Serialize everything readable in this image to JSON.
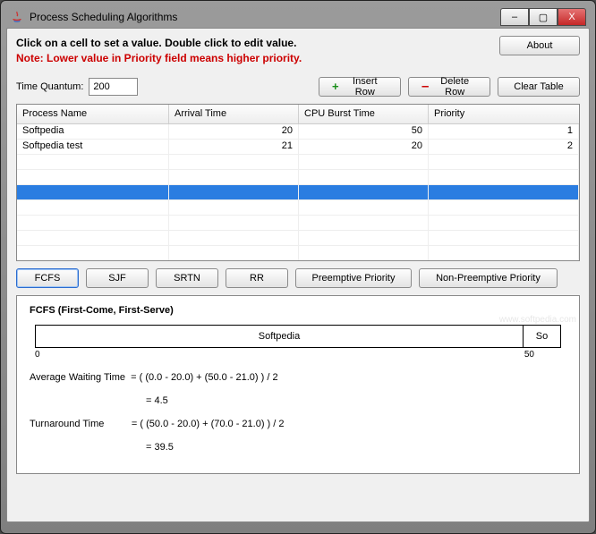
{
  "window": {
    "title": "Process Scheduling Algorithms"
  },
  "instructions": {
    "line1": "Click on a cell to set a value. Double click to edit value.",
    "line2": "Note: Lower value in Priority field means higher priority."
  },
  "about_label": "About",
  "quantum": {
    "label": "Time Quantum:",
    "value": "200"
  },
  "row_buttons": {
    "insert": "Insert Row",
    "delete": "Delete Row",
    "clear": "Clear Table"
  },
  "table": {
    "headers": [
      "Process Name",
      "Arrival Time",
      "CPU Burst Time",
      "Priority"
    ],
    "rows": [
      {
        "name": "Softpedia",
        "arrival": "20",
        "burst": "50",
        "priority": "1",
        "selected": false
      },
      {
        "name": "Softpedia test",
        "arrival": "21",
        "burst": "20",
        "priority": "2",
        "selected": false
      },
      {
        "name": "",
        "arrival": "",
        "burst": "",
        "priority": "",
        "selected": false
      },
      {
        "name": "",
        "arrival": "",
        "burst": "",
        "priority": "",
        "selected": false
      },
      {
        "name": "",
        "arrival": "",
        "burst": "",
        "priority": "",
        "selected": true
      },
      {
        "name": "",
        "arrival": "",
        "burst": "",
        "priority": "",
        "selected": false
      },
      {
        "name": "",
        "arrival": "",
        "burst": "",
        "priority": "",
        "selected": false
      },
      {
        "name": "",
        "arrival": "",
        "burst": "",
        "priority": "",
        "selected": false
      },
      {
        "name": "",
        "arrival": "",
        "burst": "",
        "priority": "",
        "selected": false
      }
    ]
  },
  "algos": {
    "fcfs": "FCFS",
    "sjf": "SJF",
    "srtn": "SRTN",
    "rr": "RR",
    "pprio": "Preemptive Priority",
    "npprio": "Non-Preemptive Priority"
  },
  "result": {
    "title": "FCFS (First-Come, First-Serve)",
    "gantt": {
      "segments": [
        {
          "label": "Softpedia",
          "width_pct": 93
        },
        {
          "label": "So",
          "width_pct": 7
        }
      ],
      "ticks": {
        "t0": "0",
        "t50": "50",
        "t50_pos_pct": 93
      }
    },
    "eq1_label": "Average Waiting Time",
    "eq1_rhs1": "=  ( (0.0 - 20.0) + (50.0 - 21.0) ) / 2",
    "eq1_rhs2": "=  4.5",
    "eq2_label": "Turnaround Time",
    "eq2_rhs1": "=  ( (50.0 - 20.0) + (70.0 - 21.0) ) / 2",
    "eq2_rhs2": "=  39.5"
  },
  "watermark": "www.softpedia.com",
  "win_controls": {
    "min": "–",
    "max": "▢",
    "close": "X"
  }
}
